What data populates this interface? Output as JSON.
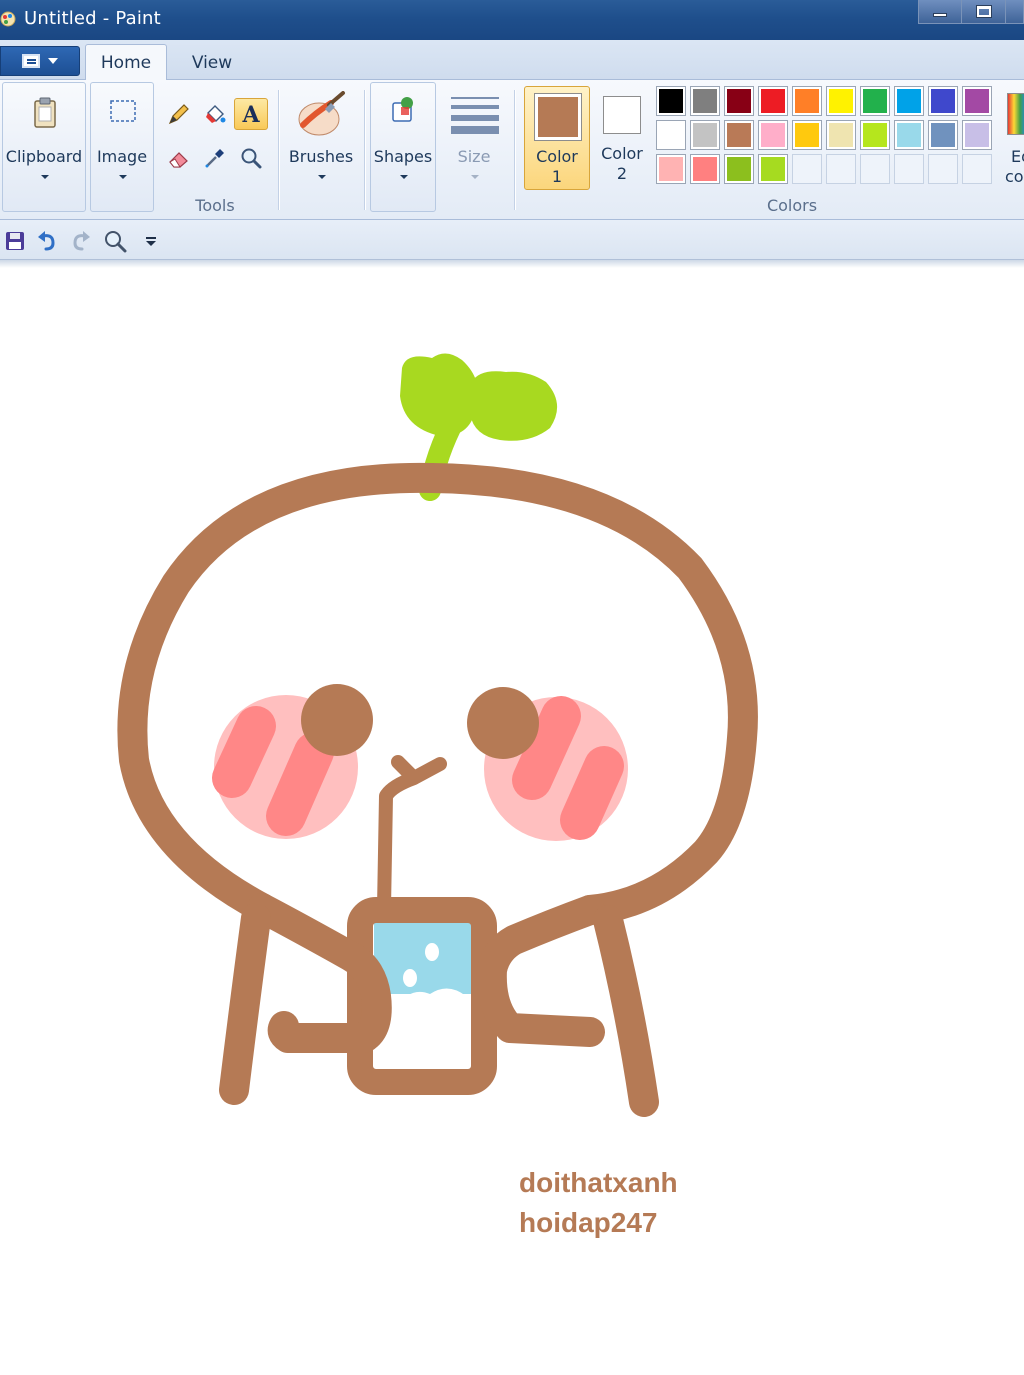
{
  "window": {
    "title": "Untitled - Paint"
  },
  "tabs": {
    "home": "Home",
    "view": "View"
  },
  "ribbon": {
    "clipboard": "Clipboard",
    "image": "Image",
    "tools_group": "Tools",
    "brushes": "Brushes",
    "shapes": "Shapes",
    "size": "Size",
    "color1": {
      "line1": "Color",
      "line2": "1",
      "value": "#b57a55"
    },
    "color2": {
      "line1": "Color",
      "line2": "2",
      "value": "#ffffff"
    },
    "colors_group": "Colors",
    "edit_colors": {
      "line1": "Ed",
      "line2": "co"
    },
    "palette_row1": [
      "#000000",
      "#7f7f7f",
      "#880015",
      "#ed1c24",
      "#ff7f27",
      "#fff200",
      "#22b14c",
      "#00a2e8",
      "#3f48cc",
      "#a349a4"
    ],
    "palette_row2": [
      "#ffffff",
      "#c3c3c3",
      "#b97a57",
      "#ffaec9",
      "#ffc90e",
      "#efe4b0",
      "#b5e61d",
      "#99d9ea",
      "#7092be",
      "#c8bfe7"
    ],
    "palette_row3": [
      "#ffb3b3",
      "#ff8080",
      "#8cbf1e",
      "#a6db20",
      "",
      "",
      "",
      "",
      "",
      ""
    ]
  },
  "quick_access": {
    "items": [
      "save-icon",
      "undo-icon",
      "redo-icon",
      "zoom-icon",
      "customize-icon"
    ]
  },
  "canvas": {
    "text_line1": "doithatxanh",
    "text_line2": "hoidap247",
    "stroke_color": "#b57a55",
    "leaf_color": "#a8d920",
    "cheek_color": "#ffbfbf",
    "blush_color": "#ff8787",
    "water_color": "#99d9ea"
  }
}
